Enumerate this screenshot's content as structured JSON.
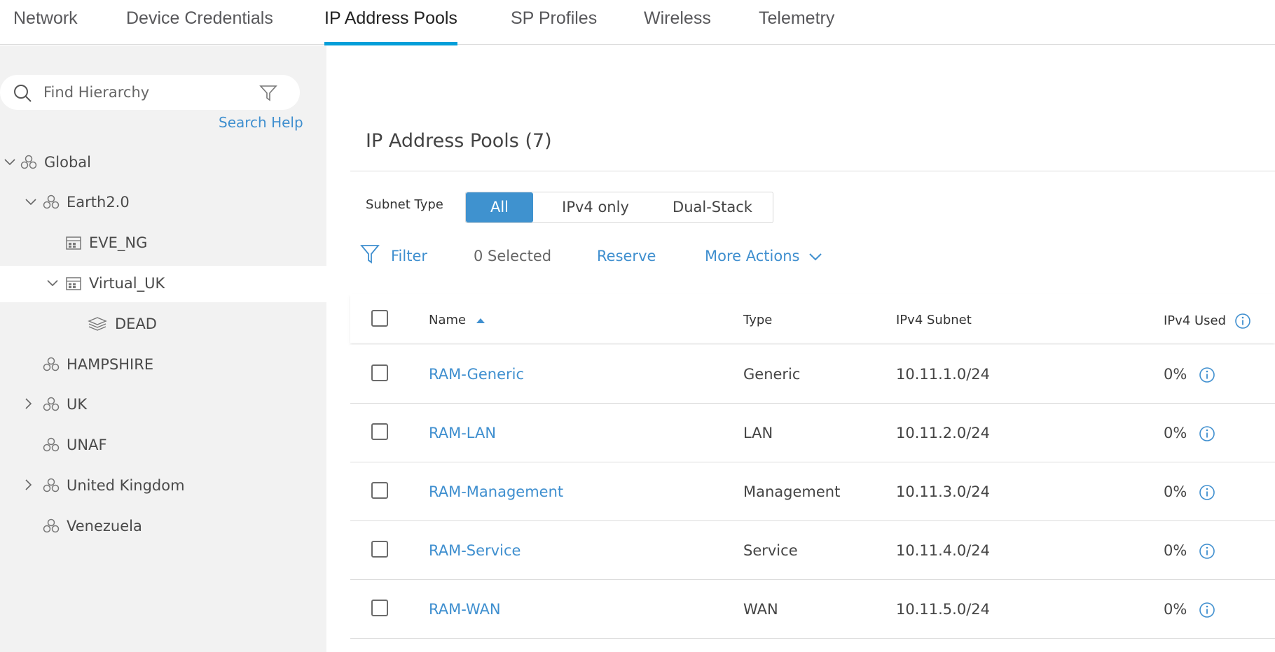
{
  "tabs": [
    {
      "label": "Network",
      "active": false
    },
    {
      "label": "Device Credentials",
      "active": false
    },
    {
      "label": "IP Address Pools",
      "active": true
    },
    {
      "label": "SP Profiles",
      "active": false
    },
    {
      "label": "Wireless",
      "active": false
    },
    {
      "label": "Telemetry",
      "active": false
    }
  ],
  "sidebar": {
    "search": {
      "placeholder": "Find Hierarchy",
      "value": ""
    },
    "search_help": "Search Help",
    "tree": [
      {
        "label": "Global",
        "icon": "area-icon",
        "expander": "expanded"
      },
      {
        "label": "Earth2.0",
        "icon": "area-icon",
        "expander": "expanded"
      },
      {
        "label": "EVE_NG",
        "icon": "building-icon",
        "expander": "none"
      },
      {
        "label": "Virtual_UK",
        "icon": "building-icon",
        "expander": "expanded",
        "selected": true
      },
      {
        "label": "DEAD",
        "icon": "floor-icon",
        "expander": "none"
      },
      {
        "label": "HAMPSHIRE",
        "icon": "area-icon",
        "expander": "none"
      },
      {
        "label": "UK",
        "icon": "area-icon",
        "expander": "collapsed"
      },
      {
        "label": "UNAF",
        "icon": "area-icon",
        "expander": "none"
      },
      {
        "label": "United Kingdom",
        "icon": "area-icon",
        "expander": "collapsed"
      },
      {
        "label": "Venezuela",
        "icon": "area-icon",
        "expander": "none"
      }
    ]
  },
  "main": {
    "title": "IP Address Pools (7)",
    "subnet_type_label": "Subnet Type",
    "subnet_types": [
      "All",
      "IPv4 only",
      "Dual-Stack"
    ],
    "subnet_type_selected": "All",
    "toolbar": {
      "filter": "Filter",
      "selected": "0 Selected",
      "reserve": "Reserve",
      "more_actions": "More Actions"
    },
    "table": {
      "columns": [
        "Name",
        "Type",
        "IPv4 Subnet",
        "IPv4 Used"
      ],
      "sort_column": "Name",
      "sort_direction": "ascending",
      "rows": [
        {
          "name": "RAM-Generic",
          "type": "Generic",
          "subnet": "10.11.1.0/24",
          "used": "0%"
        },
        {
          "name": "RAM-LAN",
          "type": "LAN",
          "subnet": "10.11.2.0/24",
          "used": "0%"
        },
        {
          "name": "RAM-Management",
          "type": "Management",
          "subnet": "10.11.3.0/24",
          "used": "0%"
        },
        {
          "name": "RAM-Service",
          "type": "Service",
          "subnet": "10.11.4.0/24",
          "used": "0%"
        },
        {
          "name": "RAM-WAN",
          "type": "WAN",
          "subnet": "10.11.5.0/24",
          "used": "0%"
        }
      ]
    }
  },
  "colors": {
    "accent": "#049fd9",
    "link": "#3f8fcf",
    "segment_active": "#3f92cf",
    "sidebar_bg": "#f2f2f2"
  }
}
